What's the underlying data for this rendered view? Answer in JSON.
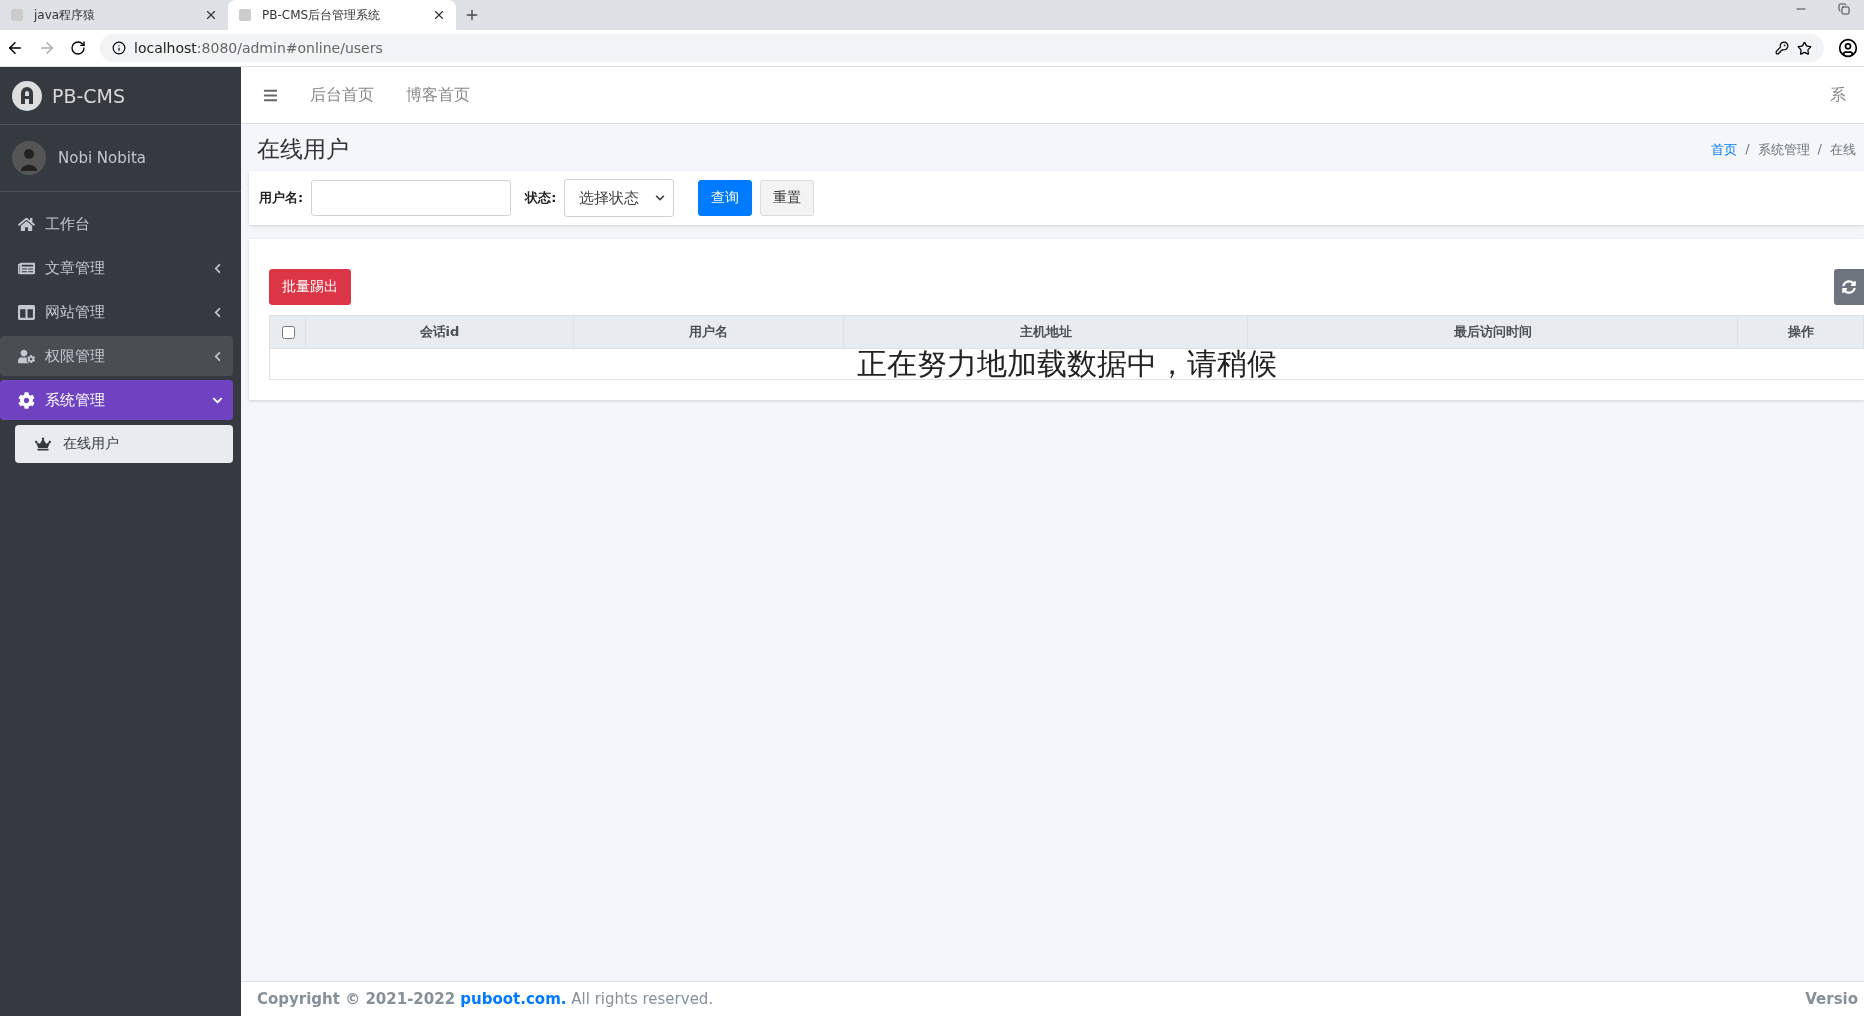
{
  "browser": {
    "tabs": [
      {
        "title": "java程序猿",
        "selected": false
      },
      {
        "title": "PB-CMS后台管理系统",
        "selected": true
      }
    ],
    "url_host": "localhost",
    "url_rest": ":8080/admin#online/users"
  },
  "sidebar": {
    "brand": "PB-CMS",
    "user": "Nobi Nobita",
    "items": [
      {
        "label": "工作台",
        "hovered": false,
        "selected": false,
        "expandable": false
      },
      {
        "label": "文章管理",
        "hovered": false,
        "selected": false,
        "expandable": true,
        "expanded": false
      },
      {
        "label": "网站管理",
        "hovered": false,
        "selected": false,
        "expandable": true,
        "expanded": false
      },
      {
        "label": "权限管理",
        "hovered": true,
        "selected": false,
        "expandable": true,
        "expanded": false
      },
      {
        "label": "系统管理",
        "hovered": false,
        "selected": true,
        "expandable": true,
        "expanded": true,
        "children": [
          {
            "label": "在线用户",
            "selected": true
          }
        ]
      }
    ]
  },
  "topnav": {
    "links": [
      "后台首页",
      "博客首页"
    ],
    "right": "系"
  },
  "page": {
    "title": "在线用户",
    "breadcrumb": [
      "首页",
      "系统管理",
      "在线"
    ],
    "breadcrumb_separator": "/"
  },
  "search": {
    "fields": [
      {
        "label": "用户名:",
        "kind": "input"
      },
      {
        "label": "状态:",
        "kind": "select",
        "value": "选择状态"
      }
    ],
    "buttons": [
      {
        "label": "查询",
        "kind": "primary"
      },
      {
        "label": "重置",
        "kind": "default"
      }
    ]
  },
  "table": {
    "toolbar_button": "批量踢出",
    "select_all_checked": false,
    "columns": [
      "会话id",
      "用户名",
      "主机地址",
      "最后访问时间",
      "操作"
    ],
    "loading_text": "正在努力地加载数据中，请稍候"
  },
  "footer": {
    "copyright": "Copyright © 2021-2022 ",
    "link": "puboot.com.",
    "rest": " All rights reserved.",
    "version": "Versio"
  }
}
